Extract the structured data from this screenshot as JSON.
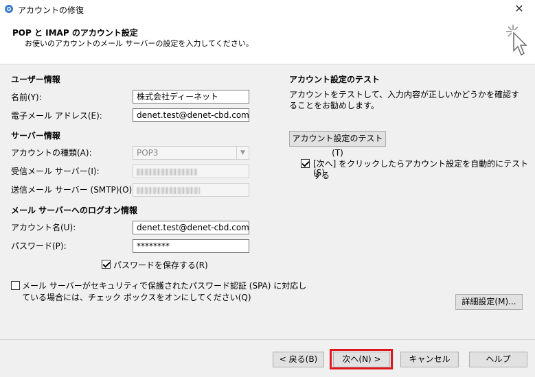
{
  "window": {
    "title": "アカウントの修復",
    "close_glyph": "✕"
  },
  "header": {
    "title": "POP と IMAP のアカウント設定",
    "subtitle": "お使いのアカウントのメール サーバーの設定を入力してください。"
  },
  "user_info": {
    "heading": "ユーザー情報",
    "name_label": "名前(Y):",
    "name_value": "株式会社ディーネット",
    "email_label": "電子メール アドレス(E):",
    "email_value": "denet.test@denet-cbd.com"
  },
  "server_info": {
    "heading": "サーバー情報",
    "account_type_label": "アカウントの種類(A):",
    "account_type_value": "POP3",
    "incoming_label": "受信メール サーバー(I):",
    "outgoing_label": "送信メール サーバー (SMTP)(O):"
  },
  "logon_info": {
    "heading": "メール サーバーへのログオン情報",
    "account_name_label": "アカウント名(U):",
    "account_name_value": "denet.test@denet-cbd.com",
    "password_label": "パスワード(P):",
    "password_value": "********",
    "save_password_label": "パスワードを保存する(R)",
    "save_password_checked": true,
    "spa_label_line1": "メール サーバーがセキュリティで保護されたパスワード認証 (SPA) に対応し",
    "spa_label_line2": "ている場合には、チェック ボックスをオンにしてください(Q)",
    "spa_checked": false
  },
  "test": {
    "heading": "アカウント設定のテスト",
    "description": "アカウントをテストして、入力内容が正しいかどうかを確認することをお勧めします。",
    "test_button": "アカウント設定のテスト(T)",
    "auto_test_label_line1": "[次へ] をクリックしたらアカウント設定を自動的にテストする",
    "auto_test_label_line2": "(S)",
    "auto_test_checked": true
  },
  "advanced_button": "詳細設定(M)...",
  "footer": {
    "back": "< 戻る(B)",
    "next": "次へ(N) >",
    "cancel": "キャンセル",
    "help": "ヘルプ"
  },
  "colors": {
    "highlight": "#e0161c"
  }
}
